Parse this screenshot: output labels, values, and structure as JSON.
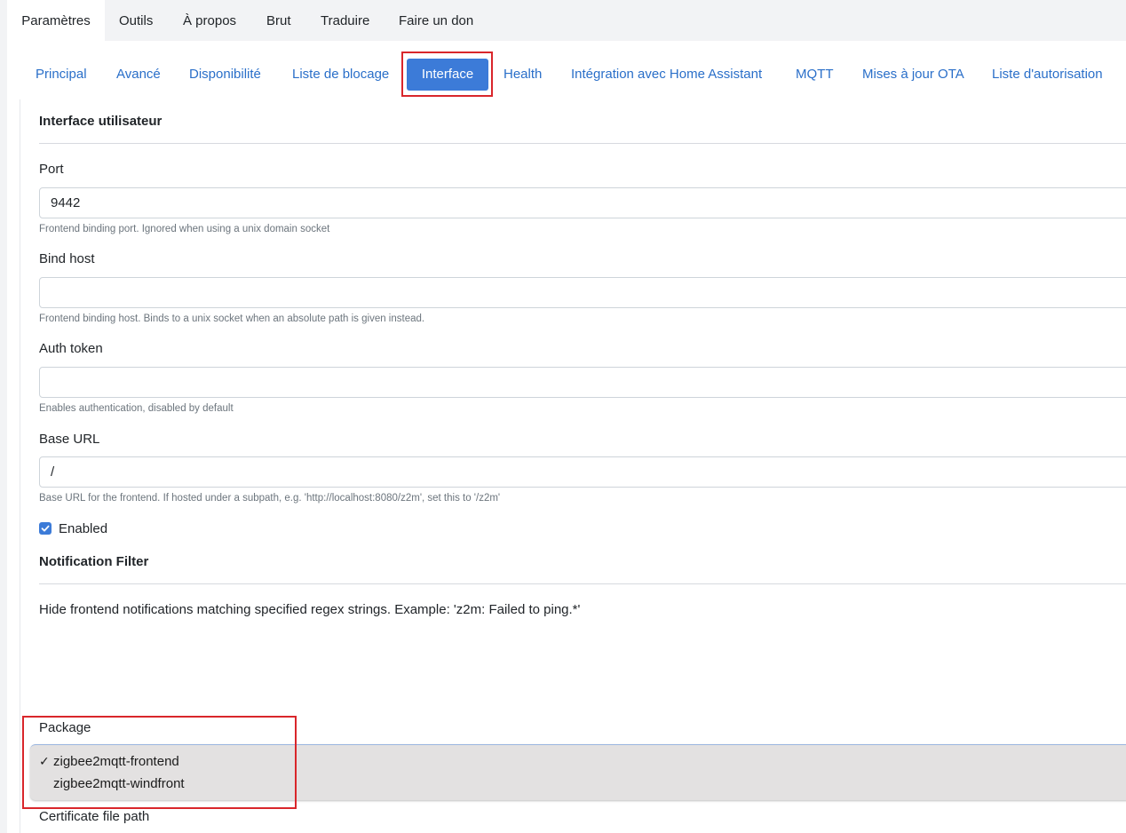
{
  "top_tabs": [
    "Paramètres",
    "Outils",
    "À propos",
    "Brut",
    "Traduire",
    "Faire un don"
  ],
  "sub_tabs": [
    "Principal",
    "Avancé",
    "Disponibilité",
    "Liste de blocage",
    "Interface",
    "Health",
    "Intégration avec Home Assistant",
    "MQTT",
    "Mises à jour OTA",
    "Liste d'autorisation"
  ],
  "active_top_tab": "Paramètres",
  "active_sub_tab": "Interface",
  "section": {
    "title": "Interface utilisateur"
  },
  "fields": {
    "port": {
      "label": "Port",
      "value": "9442",
      "help": "Frontend binding port. Ignored when using a unix domain socket"
    },
    "bind_host": {
      "label": "Bind host",
      "value": "",
      "help": "Frontend binding host. Binds to a unix socket when an absolute path is given instead."
    },
    "auth_token": {
      "label": "Auth token",
      "value": "",
      "help": "Enables authentication, disabled by default"
    },
    "base_url": {
      "label": "Base URL",
      "value": "/",
      "help": "Base URL for the frontend. If hosted under a subpath, e.g. 'http://localhost:8080/z2m', set this to '/z2m'"
    }
  },
  "enabled": {
    "label": "Enabled",
    "checked": true
  },
  "notification_filter": {
    "title": "Notification Filter",
    "description": "Hide frontend notifications matching specified regex strings. Example: 'z2m: Failed to ping.*'"
  },
  "package": {
    "label": "Package",
    "options": [
      {
        "check": "✓",
        "label": "zigbee2mqtt-frontend"
      },
      {
        "check": "",
        "label": "zigbee2mqtt-windfront"
      }
    ]
  },
  "next_field": {
    "label": "Certificate file path"
  },
  "colors": {
    "accent": "#3c7bd8",
    "highlight": "#d9262b",
    "link": "#2a6fc9"
  }
}
